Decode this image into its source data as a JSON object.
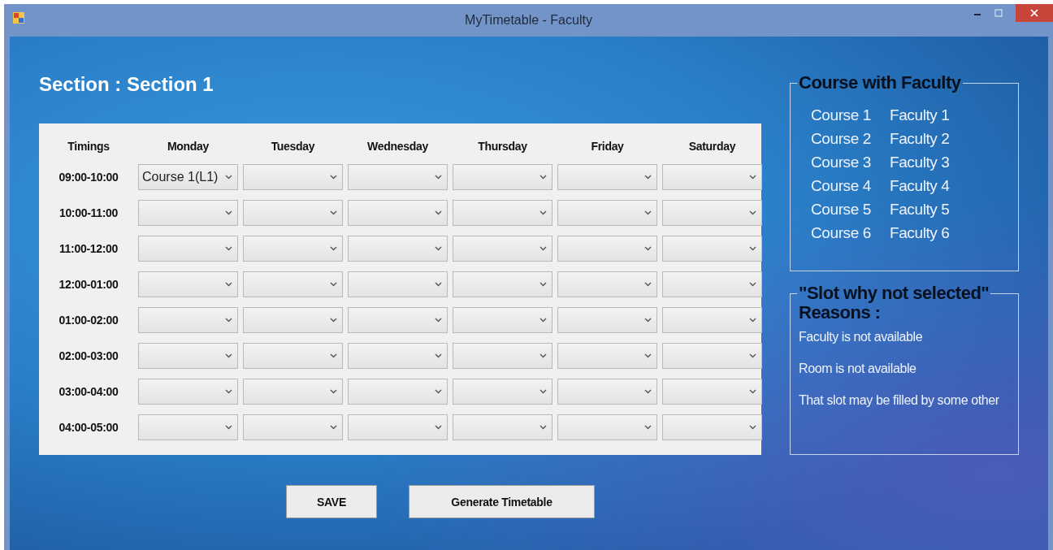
{
  "window": {
    "title": "MyTimetable - Faculty"
  },
  "section_title": "Section : Section 1",
  "timetable": {
    "time_header": "Timings",
    "days": [
      "Monday",
      "Tuesday",
      "Wednesday",
      "Thursday",
      "Friday",
      "Saturday"
    ],
    "rows": [
      {
        "time": "09:00-10:00",
        "cells": [
          {
            "value": "Course 1(L1)"
          },
          {},
          {},
          {},
          {},
          {}
        ]
      },
      {
        "time": "10:00-11:00",
        "cells": [
          {},
          {},
          {},
          {},
          {},
          {}
        ]
      },
      {
        "time": "11:00-12:00",
        "cells": [
          {},
          {},
          {},
          {},
          {},
          {}
        ]
      },
      {
        "time": "12:00-01:00",
        "cells": [
          {},
          {},
          {},
          {},
          {},
          {}
        ]
      },
      {
        "time": "01:00-02:00",
        "cells": [
          {},
          {},
          {},
          {},
          {},
          {}
        ]
      },
      {
        "time": "02:00-03:00",
        "cells": [
          {},
          {},
          {},
          {},
          {},
          {}
        ]
      },
      {
        "time": "03:00-04:00",
        "cells": [
          {},
          {},
          {},
          {},
          {},
          {}
        ]
      },
      {
        "time": "04:00-05:00",
        "cells": [
          {},
          {},
          {},
          {},
          {},
          {}
        ]
      }
    ]
  },
  "buttons": [
    "SAVE",
    "Generate Timetable"
  ],
  "course_with_faculty": {
    "title": "Course with Faculty",
    "pairs": [
      {
        "course": "Course 1",
        "faculty": "Faculty 1"
      },
      {
        "course": "Course 2",
        "faculty": "Faculty 2"
      },
      {
        "course": "Course 3",
        "faculty": "Faculty 3"
      },
      {
        "course": "Course 4",
        "faculty": "Faculty 4"
      },
      {
        "course": "Course 5",
        "faculty": "Faculty 5"
      },
      {
        "course": "Course 6",
        "faculty": "Faculty 6"
      }
    ]
  },
  "reasons": {
    "title": "\"Slot why not selected\"",
    "subtitle": "Reasons :",
    "items": [
      "Faculty is not available",
      "Room is not available",
      "That slot may be filled by some other"
    ]
  }
}
